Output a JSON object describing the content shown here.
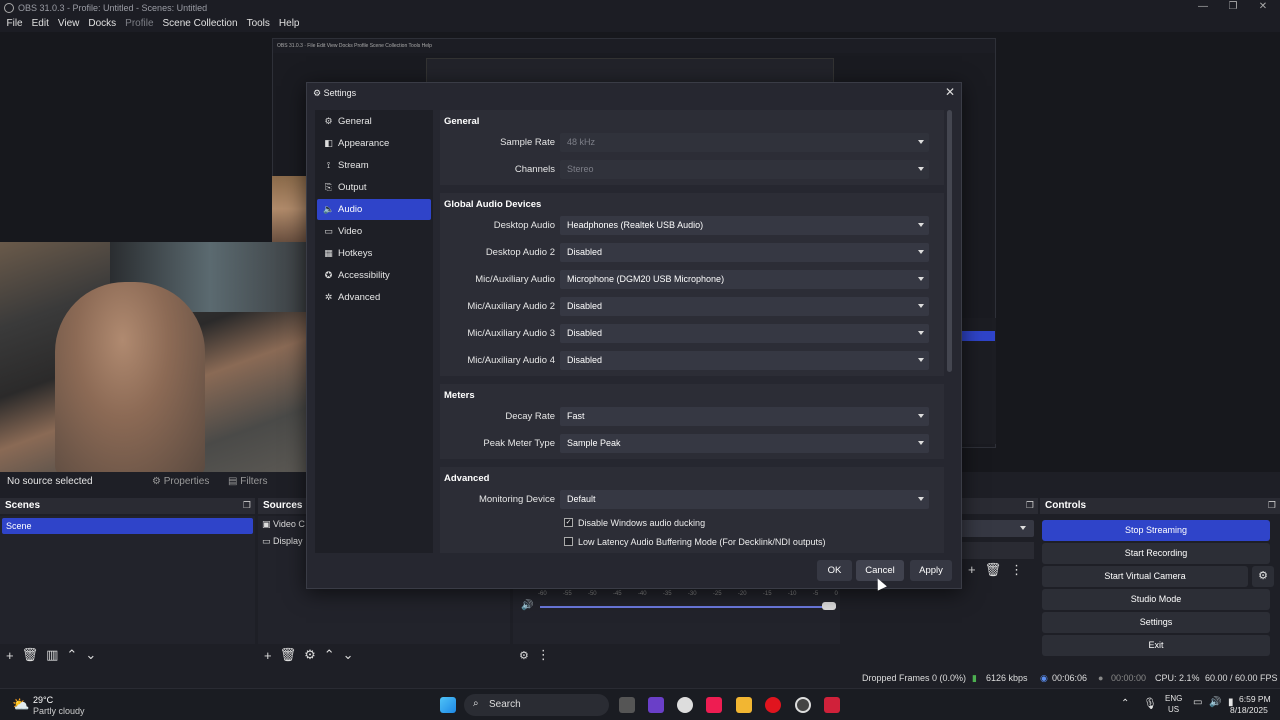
{
  "window": {
    "title": "OBS 31.0.3 - Profile: Untitled - Scenes: Untitled"
  },
  "menu": [
    "File",
    "Edit",
    "View",
    "Docks",
    "Profile",
    "Scene Collection",
    "Tools",
    "Help"
  ],
  "source_bar": {
    "no_source": "No source selected",
    "properties": "Properties",
    "filters": "Filters"
  },
  "scenes": {
    "title": "Scenes",
    "items": [
      "Scene"
    ]
  },
  "sources": {
    "title": "Sources",
    "items": [
      "Video C",
      "Display"
    ]
  },
  "controls": {
    "title": "Controls",
    "stop_streaming": "Stop Streaming",
    "start_recording": "Start Recording",
    "start_virtual_camera": "Start Virtual Camera",
    "studio_mode": "Studio Mode",
    "settings": "Settings",
    "exit": "Exit"
  },
  "mixer_ticks": [
    "-60",
    "-55",
    "-50",
    "-45",
    "-40",
    "-35",
    "-30",
    "-25",
    "-20",
    "-15",
    "-10",
    "-5",
    "0"
  ],
  "status": {
    "dropped": "Dropped Frames 0 (0.0%)",
    "bitrate": "6126 kbps",
    "stream_time": "00:06:06",
    "rec_time": "00:00:00",
    "cpu": "CPU: 2.1%",
    "fps": "60.00 / 60.00 FPS"
  },
  "settings": {
    "title": "Settings",
    "nav": [
      {
        "label": "General",
        "icon": "gear-icon"
      },
      {
        "label": "Appearance",
        "icon": "appearance-icon"
      },
      {
        "label": "Stream",
        "icon": "stream-icon"
      },
      {
        "label": "Output",
        "icon": "output-icon"
      },
      {
        "label": "Audio",
        "icon": "speaker-icon"
      },
      {
        "label": "Video",
        "icon": "monitor-icon"
      },
      {
        "label": "Hotkeys",
        "icon": "keyboard-icon"
      },
      {
        "label": "Accessibility",
        "icon": "accessibility-icon"
      },
      {
        "label": "Advanced",
        "icon": "wrench-icon"
      }
    ],
    "selected_nav": "Audio",
    "general": {
      "title": "General",
      "sample_rate_label": "Sample Rate",
      "sample_rate": "48 kHz",
      "channels_label": "Channels",
      "channels": "Stereo"
    },
    "devices": {
      "title": "Global Audio Devices",
      "rows": [
        {
          "label": "Desktop Audio",
          "value": "Headphones (Realtek USB Audio)"
        },
        {
          "label": "Desktop Audio 2",
          "value": "Disabled"
        },
        {
          "label": "Mic/Auxiliary Audio",
          "value": "Microphone (DGM20 USB Microphone)"
        },
        {
          "label": "Mic/Auxiliary Audio 2",
          "value": "Disabled"
        },
        {
          "label": "Mic/Auxiliary Audio 3",
          "value": "Disabled"
        },
        {
          "label": "Mic/Auxiliary Audio 4",
          "value": "Disabled"
        }
      ]
    },
    "meters": {
      "title": "Meters",
      "decay_label": "Decay Rate",
      "decay": "Fast",
      "peak_label": "Peak Meter Type",
      "peak": "Sample Peak"
    },
    "advanced": {
      "title": "Advanced",
      "monitoring_label": "Monitoring Device",
      "monitoring": "Default",
      "ducking": "Disable Windows audio ducking",
      "ducking_checked": "✓",
      "low_latency": "Low Latency Audio Buffering Mode (For Decklink/NDI outputs)"
    },
    "buttons": {
      "ok": "OK",
      "cancel": "Cancel",
      "apply": "Apply"
    }
  },
  "taskbar": {
    "temp": "29°C",
    "weather": "Partly cloudy",
    "search": "Search",
    "lang1": "ENG",
    "lang2": "US",
    "time": "6:59 PM",
    "date": "8/18/2025"
  }
}
